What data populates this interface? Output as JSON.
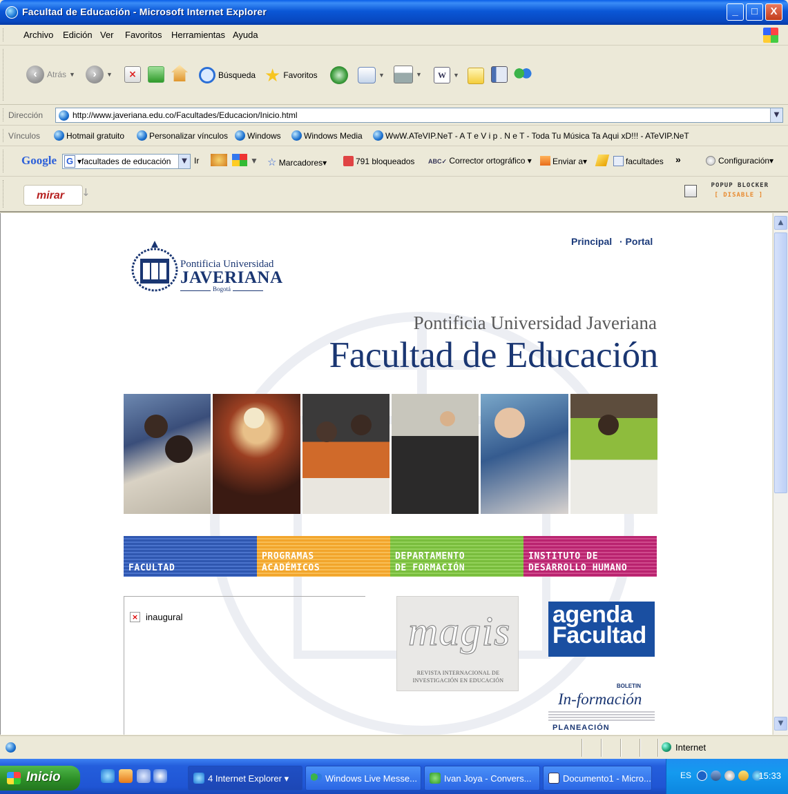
{
  "window": {
    "title": "Facultad de Educación - Microsoft Internet Explorer",
    "controls": [
      "_",
      "□",
      "X"
    ]
  },
  "menu": [
    "Archivo",
    "Edición",
    "Ver",
    "Favoritos",
    "Herramientas",
    "Ayuda"
  ],
  "toolbar": {
    "back": "Atrás",
    "search": "Búsqueda",
    "favorites": "Favoritos"
  },
  "address": {
    "label": "Dirección",
    "url": "http://www.javeriana.edu.co/Facultades/Educacion/Inicio.html"
  },
  "links": {
    "label": "Vínculos",
    "items": [
      "Hotmail gratuito",
      "Personalizar vínculos",
      "Windows",
      "Windows Media",
      "WwW.ATeVIP.NeT - A T e V i p . N e T - Toda Tu Música Ta Aqui xD!!! - ATeVIP.NeT"
    ]
  },
  "google": {
    "logo": "Google",
    "query": "facultades de educación",
    "go": "Ir",
    "bookmarks": "Marcadores",
    "blocked": "791 bloqueados",
    "spell": "Corrector ortográfico",
    "send": "Enviar a",
    "term": "facultades",
    "more": "»",
    "settings": "Configuración"
  },
  "mirar": {
    "logo": "mirar",
    "popup_title": "POPUP BLOCKER",
    "popup_state": "[ DISABLE ]"
  },
  "page": {
    "topnav": [
      "Principal",
      "· Portal"
    ],
    "university": {
      "line1": "Pontificia Universidad",
      "line2": "JAVERIANA",
      "line3": "Bogotá"
    },
    "hero": {
      "line1": "Pontificia Universidad Javeriana",
      "line2": "Facultad de Educación"
    },
    "nav": [
      {
        "l1": "",
        "l2": "FACULTAD",
        "color": "#2f57b0"
      },
      {
        "l1": "PROGRAMAS",
        "l2": "ACADÉMICOS",
        "color": "#f2a52b"
      },
      {
        "l1": "DEPARTAMENTO",
        "l2": "DE FORMACIÓN",
        "color": "#79bd3d"
      },
      {
        "l1": "INSTITUTO DE",
        "l2": "DESARROLLO HUMANO",
        "color": "#b9236f"
      }
    ],
    "broken_image": "inaugural",
    "magis": {
      "title": "magis",
      "sub1": "REVISTA INTERNACIONAL DE",
      "sub2": "INVESTIGACIÓN EN EDUCACIÓN"
    },
    "agenda": {
      "l1": "agenda",
      "l2": "Facultad"
    },
    "boletin": {
      "tag": "BOLETIN",
      "name": "In-formación",
      "sub": "PLANEACIÓN"
    }
  },
  "status": {
    "zone": "Internet"
  },
  "taskbar": {
    "start": "Inicio",
    "tasks": [
      "4 Internet Explorer",
      "Windows Live Messe...",
      "Ivan Joya - Convers...",
      "Documento1 - Micro..."
    ],
    "lang": "ES",
    "time": "15:33"
  }
}
